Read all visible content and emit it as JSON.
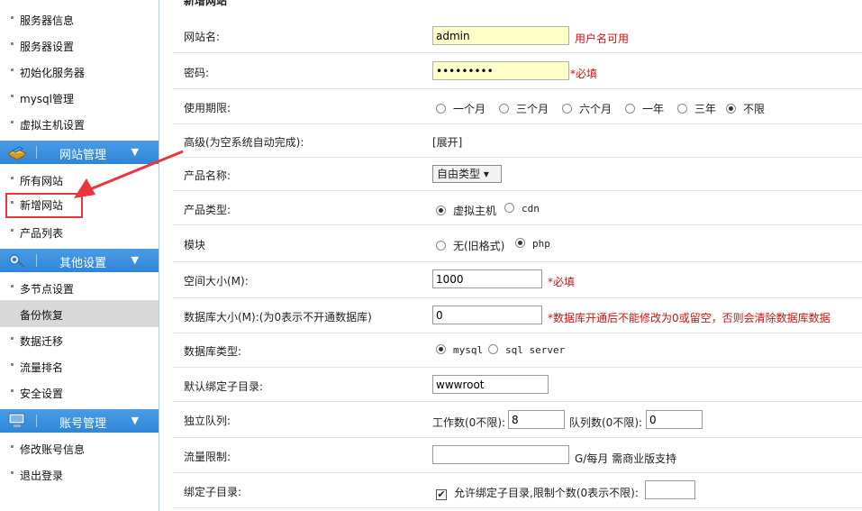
{
  "sidebar": {
    "items_top": [
      "服务器信息",
      "服务器设置",
      "初始化服务器",
      "mysql管理",
      "虚拟主机设置"
    ],
    "section_site": "网站管理",
    "items_site": [
      "所有网站",
      "新增网站",
      "产品列表"
    ],
    "section_other": "其他设置",
    "items_other": [
      "多节点设置",
      "备份恢复",
      "数据迁移",
      "流量排名",
      "安全设置"
    ],
    "section_account": "账号管理",
    "items_account": [
      "修改账号信息",
      "退出登录"
    ],
    "arrow_color": "#e8373d",
    "header_color": "#3a8fdd"
  },
  "form": {
    "title": "新增网站",
    "site_name": {
      "label": "网站名:",
      "value": "admin",
      "status": "用户名可用"
    },
    "password": {
      "label": "密码:",
      "value": "•••••••••",
      "required": "*必填"
    },
    "period": {
      "label": "使用期限:",
      "options": [
        "一个月",
        "三个月",
        "六个月",
        "一年",
        "三年",
        "不限"
      ],
      "selected": "不限"
    },
    "advanced": {
      "label": "高级(为空系统自动完成):",
      "link": "[展开]"
    },
    "product_name": {
      "label": "产品名称:",
      "selected": "自由类型 ▾"
    },
    "product_type": {
      "label": "产品类型:",
      "options": [
        "虚拟主机",
        "cdn"
      ],
      "selected": "虚拟主机"
    },
    "module": {
      "label": "模块",
      "options": [
        "无(旧格式)",
        "php"
      ],
      "selected": "php"
    },
    "space": {
      "label": "空间大小(M):",
      "value": "1000",
      "required": "*必填"
    },
    "db_size": {
      "label": "数据库大小(M):(为0表示不开通数据库)",
      "value": "0",
      "note": "*数据库开通后不能修改为0或留空，否则会清除数据库数据"
    },
    "db_type": {
      "label": "数据库类型:",
      "options": [
        "mysql",
        "sql server"
      ],
      "selected": "mysql"
    },
    "default_dir": {
      "label": "默认绑定子目录:",
      "value": "wwwroot"
    },
    "queue": {
      "label": "独立队列:",
      "workers_label": "工作数(0不限):",
      "workers": "8",
      "queues_label": "队列数(0不限):",
      "queues": "0"
    },
    "traffic": {
      "label": "流量限制:",
      "value": "",
      "unit": "G/每月 需商业版支持"
    },
    "bind_dir": {
      "label": "绑定子目录:",
      "checkbox_label": "允许绑定子目录,限制个数(0表示不限):",
      "checked": true,
      "value": ""
    }
  }
}
